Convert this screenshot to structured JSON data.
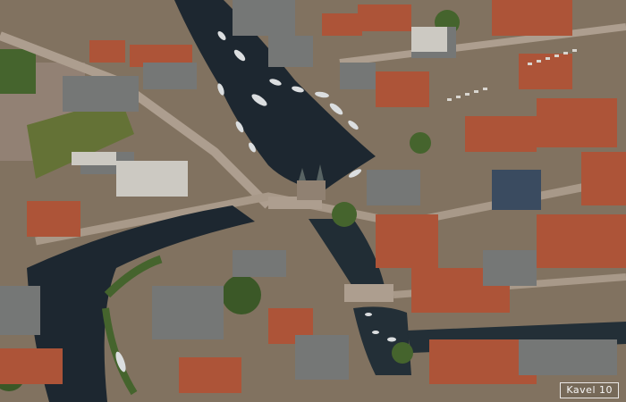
{
  "photo": {
    "watermark_text": "Kavel 10",
    "colors": {
      "water": "#1f2a33",
      "roof_red": "#b85a3c",
      "roof_grey": "#7d7f7e",
      "street": "#a89a8a",
      "greenery": "#3f5e2a",
      "boat_white": "#e9ecee"
    }
  }
}
